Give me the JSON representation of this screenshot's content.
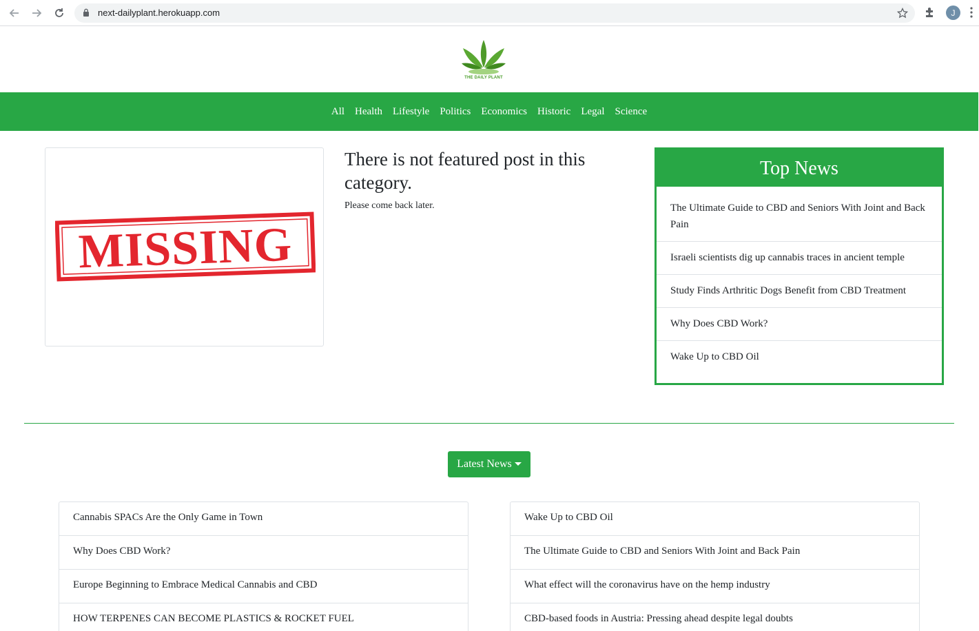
{
  "browser": {
    "url": "next-dailyplant.herokuapp.com",
    "profile_initial": "J"
  },
  "site": {
    "logo_text": "THE DAILY PLANT"
  },
  "nav": {
    "items": [
      "All",
      "Health",
      "Lifestyle",
      "Politics",
      "Economics",
      "Historic",
      "Legal",
      "Science"
    ]
  },
  "featured": {
    "image_text": "MISSING",
    "title": "There is not featured post in this category.",
    "subtitle": "Please come back later."
  },
  "top_news": {
    "title": "Top News",
    "items": [
      "The Ultimate Guide to CBD and Seniors With Joint and Back Pain",
      "Israeli scientists dig up cannabis traces in ancient temple",
      "Study Finds Arthritic Dogs Benefit from CBD Treatment",
      "Why Does CBD Work?",
      "Wake Up to CBD Oil"
    ]
  },
  "latest": {
    "button_label": "Latest News",
    "left": [
      "Cannabis SPACs Are the Only Game in Town",
      "Why Does CBD Work?",
      "Europe Beginning to Embrace Medical Cannabis and CBD",
      "HOW TERPENES CAN BECOME PLASTICS & ROCKET FUEL"
    ],
    "right": [
      "Wake Up to CBD Oil",
      "The Ultimate Guide to CBD and Seniors With Joint and Back Pain",
      "What effect will the coronavirus have on the hemp industry",
      "CBD-based foods in Austria: Pressing ahead despite legal doubts"
    ]
  },
  "colors": {
    "brand_green": "#28a745",
    "missing_red": "#e3262e"
  }
}
